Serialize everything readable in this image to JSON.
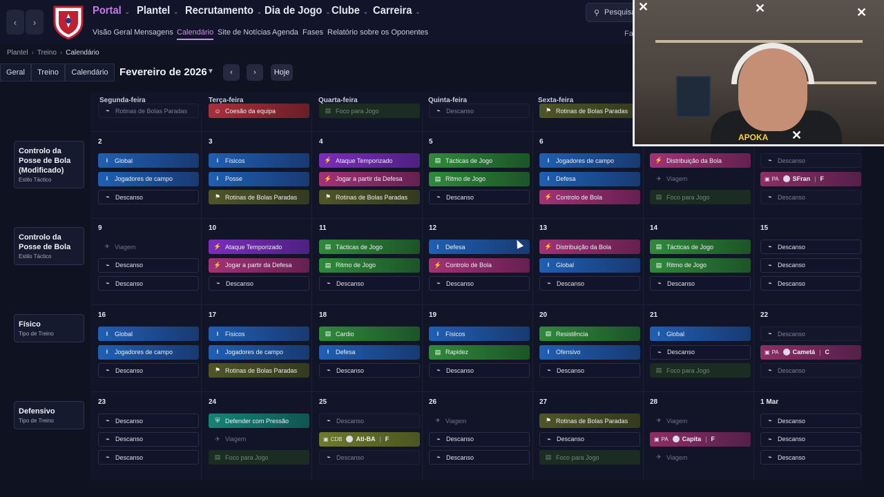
{
  "topnav": {
    "items": [
      {
        "label": "Portal",
        "active": true
      },
      {
        "label": "Plantel",
        "active": false
      },
      {
        "label": "Recrutamento",
        "active": false
      },
      {
        "label": "Dia de Jogo",
        "active": false
      },
      {
        "label": "Clube",
        "active": false
      },
      {
        "label": "Carreira",
        "active": false
      }
    ],
    "subnav": [
      {
        "label": "Visão Geral",
        "active": false
      },
      {
        "label": "Mensagens",
        "active": false
      },
      {
        "label": "Calendário",
        "active": true
      },
      {
        "label": "Site de Notícias",
        "active": false
      },
      {
        "label": "Agenda",
        "active": false
      },
      {
        "label": "Fases",
        "active": false
      },
      {
        "label": "Relatório sobre os Oponentes",
        "active": false
      }
    ],
    "search_label": "Pesquisa",
    "fav_label": "Fav",
    "accent": "#c879e8"
  },
  "breadcrumb": [
    "Plantel",
    "Treino",
    "Calendário"
  ],
  "toolbar": {
    "tabs": [
      "Geral",
      "Treino",
      "Calendário"
    ],
    "month": "Fevereiro de 2026",
    "today_label": "Hoje"
  },
  "days": [
    "Segunda-feira",
    "Terça-feira",
    "Quarta-feira",
    "Quinta-feira",
    "Sexta-feira"
  ],
  "top_partial_row": [
    {
      "label": "Rotinas de Bolas Paradas",
      "style": "fadedrest"
    },
    {
      "label": "Coesão da equipa",
      "style": "red"
    },
    {
      "label": "Foco para Jogo",
      "style": "fadedgreen"
    },
    {
      "label": "Descanso",
      "style": "fadedrest"
    },
    {
      "label": "Rotinas de Bolas Paradas",
      "style": "olive"
    }
  ],
  "weeks": [
    {
      "card": {
        "title": "Controlo da Posse de Bola (Modificado)",
        "subtitle": "Estilo Táctico"
      },
      "days": [
        {
          "date": "2",
          "slots": [
            {
              "label": "Global",
              "style": "blue"
            },
            {
              "label": "Jogadores de campo",
              "style": "blue"
            },
            {
              "label": "Descanso",
              "style": "rest"
            }
          ]
        },
        {
          "date": "3",
          "slots": [
            {
              "label": "Físicos",
              "style": "blue"
            },
            {
              "label": "Posse",
              "style": "blue"
            },
            {
              "label": "Rotinas de Bolas Paradas",
              "style": "olive"
            }
          ]
        },
        {
          "date": "4",
          "slots": [
            {
              "label": "Ataque Temporizado",
              "style": "purple"
            },
            {
              "label": "Jogar a partir da Defesa",
              "style": "pink"
            },
            {
              "label": "Rotinas de Bolas Paradas",
              "style": "olive"
            }
          ]
        },
        {
          "date": "5",
          "slots": [
            {
              "label": "Tácticas de Jogo",
              "style": "green"
            },
            {
              "label": "Ritmo de Jogo",
              "style": "green"
            },
            {
              "label": "Descanso",
              "style": "rest"
            }
          ]
        },
        {
          "date": "6",
          "slots": [
            {
              "label": "Jogadores de campo",
              "style": "blue"
            },
            {
              "label": "Defesa",
              "style": "blue"
            },
            {
              "label": "Controlo de Bola",
              "style": "pink"
            }
          ]
        },
        {
          "date": "",
          "slots": [
            {
              "label": "Distribuição da Bola",
              "style": "pink"
            },
            {
              "label": "Viagem",
              "style": "faded"
            },
            {
              "label": "Foco para Jogo",
              "style": "fadedgreen"
            }
          ]
        },
        {
          "date": "",
          "slots": [
            {
              "label": "Descanso",
              "style": "fadedrest"
            },
            {
              "kind": "match",
              "tag": "PA",
              "opponent": "SFran",
              "venue": "F",
              "style": "match"
            },
            {
              "label": "Descanso",
              "style": "fadedrest"
            }
          ]
        }
      ]
    },
    {
      "card": {
        "title": "Controlo da Posse de Bola",
        "subtitle": "Estilo Táctico"
      },
      "days": [
        {
          "date": "9",
          "slots": [
            {
              "label": "Viagem",
              "style": "faded"
            },
            {
              "label": "Descanso",
              "style": "rest"
            },
            {
              "label": "Descanso",
              "style": "rest"
            }
          ]
        },
        {
          "date": "10",
          "slots": [
            {
              "label": "Ataque Temporizado",
              "style": "purple"
            },
            {
              "label": "Jogar a partir da Defesa",
              "style": "pink"
            },
            {
              "label": "Descanso",
              "style": "rest"
            }
          ]
        },
        {
          "date": "11",
          "slots": [
            {
              "label": "Tácticas de Jogo",
              "style": "green"
            },
            {
              "label": "Ritmo de Jogo",
              "style": "green"
            },
            {
              "label": "Descanso",
              "style": "rest"
            }
          ]
        },
        {
          "date": "12",
          "slots": [
            {
              "label": "Defesa",
              "style": "blue"
            },
            {
              "label": "Controlo de Bola",
              "style": "pink"
            },
            {
              "label": "Descanso",
              "style": "rest"
            }
          ]
        },
        {
          "date": "13",
          "slots": [
            {
              "label": "Distribuição da Bola",
              "style": "pink"
            },
            {
              "label": "Global",
              "style": "blue"
            },
            {
              "label": "Descanso",
              "style": "rest"
            }
          ]
        },
        {
          "date": "14",
          "slots": [
            {
              "label": "Tácticas de Jogo",
              "style": "green"
            },
            {
              "label": "Ritmo de Jogo",
              "style": "green"
            },
            {
              "label": "Descanso",
              "style": "rest"
            }
          ]
        },
        {
          "date": "15",
          "slots": [
            {
              "label": "Descanso",
              "style": "rest"
            },
            {
              "label": "Descanso",
              "style": "rest"
            },
            {
              "label": "Descanso",
              "style": "rest"
            }
          ]
        }
      ]
    },
    {
      "card": {
        "title": "Físico",
        "subtitle": "Tipo de Treino"
      },
      "days": [
        {
          "date": "16",
          "slots": [
            {
              "label": "Global",
              "style": "blue"
            },
            {
              "label": "Jogadores de campo",
              "style": "blue"
            },
            {
              "label": "Descanso",
              "style": "rest"
            }
          ]
        },
        {
          "date": "17",
          "slots": [
            {
              "label": "Físicos",
              "style": "blue"
            },
            {
              "label": "Jogadores de campo",
              "style": "blue"
            },
            {
              "label": "Rotinas de Bolas Paradas",
              "style": "olive"
            }
          ]
        },
        {
          "date": "18",
          "slots": [
            {
              "label": "Cardio",
              "style": "green"
            },
            {
              "label": "Defesa",
              "style": "blue"
            },
            {
              "label": "Descanso",
              "style": "rest"
            }
          ]
        },
        {
          "date": "19",
          "slots": [
            {
              "label": "Físicos",
              "style": "blue"
            },
            {
              "label": "Rapidez",
              "style": "green"
            },
            {
              "label": "Descanso",
              "style": "rest"
            }
          ]
        },
        {
          "date": "20",
          "slots": [
            {
              "label": "Resistência",
              "style": "green"
            },
            {
              "label": "Ofensivo",
              "style": "blue"
            },
            {
              "label": "Descanso",
              "style": "rest"
            }
          ]
        },
        {
          "date": "21",
          "slots": [
            {
              "label": "Global",
              "style": "blue"
            },
            {
              "label": "Descanso",
              "style": "rest"
            },
            {
              "label": "Foco para Jogo",
              "style": "fadedgreen"
            }
          ]
        },
        {
          "date": "22",
          "slots": [
            {
              "label": "Descanso",
              "style": "fadedrest"
            },
            {
              "kind": "match",
              "tag": "PA",
              "opponent": "Cametá",
              "venue": "C",
              "style": "match"
            },
            {
              "label": "Descanso",
              "style": "fadedrest"
            }
          ]
        }
      ]
    },
    {
      "card": {
        "title": "Defensivo",
        "subtitle": "Tipo de Treino"
      },
      "days": [
        {
          "date": "23",
          "slots": [
            {
              "label": "Descanso",
              "style": "rest"
            },
            {
              "label": "Descanso",
              "style": "rest"
            },
            {
              "label": "Descanso",
              "style": "rest"
            }
          ]
        },
        {
          "date": "24",
          "slots": [
            {
              "label": "Defender com Pressão",
              "style": "teal"
            },
            {
              "label": "Viagem",
              "style": "faded"
            },
            {
              "label": "Foco para Jogo",
              "style": "fadedgreen"
            }
          ]
        },
        {
          "date": "25",
          "slots": [
            {
              "label": "Descanso",
              "style": "fadedrest"
            },
            {
              "kind": "match",
              "tag": "CDB",
              "opponent": "Atl-BA",
              "venue": "F",
              "style": "match cdb"
            },
            {
              "label": "Descanso",
              "style": "fadedrest"
            }
          ]
        },
        {
          "date": "26",
          "slots": [
            {
              "label": "Viagem",
              "style": "faded"
            },
            {
              "label": "Descanso",
              "style": "rest"
            },
            {
              "label": "Descanso",
              "style": "rest"
            }
          ]
        },
        {
          "date": "27",
          "slots": [
            {
              "label": "Rotinas de Bolas Paradas",
              "style": "olive"
            },
            {
              "label": "Descanso",
              "style": "rest"
            },
            {
              "label": "Foco para Jogo",
              "style": "fadedgreen"
            }
          ]
        },
        {
          "date": "28",
          "slots": [
            {
              "label": "Viagem",
              "style": "faded"
            },
            {
              "kind": "match",
              "tag": "PA",
              "opponent": "Capita",
              "venue": "F",
              "style": "match"
            },
            {
              "label": "Viagem",
              "style": "faded"
            }
          ]
        },
        {
          "date": "1 Mar",
          "slots": [
            {
              "label": "Descanso",
              "style": "rest"
            },
            {
              "label": "Descanso",
              "style": "rest"
            },
            {
              "label": "Descanso",
              "style": "rest"
            }
          ]
        }
      ]
    }
  ],
  "webcam": {
    "overlay_text": "APOKA"
  }
}
